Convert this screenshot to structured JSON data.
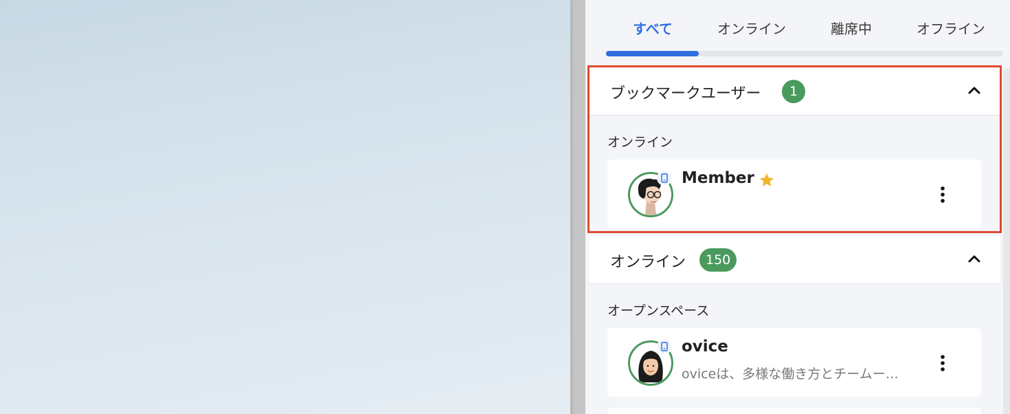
{
  "tabs": [
    {
      "label": "すべて",
      "active": true
    },
    {
      "label": "オンライン",
      "active": false
    },
    {
      "label": "離席中",
      "active": false
    },
    {
      "label": "オフライン",
      "active": false
    }
  ],
  "bookmark_section": {
    "title": "ブックマークユーザー",
    "count": "1",
    "group_label": "オンライン",
    "members": [
      {
        "name": "Member",
        "description": "",
        "bookmarked": true,
        "icon": "star-icon"
      }
    ]
  },
  "online_section": {
    "title": "オンライン",
    "count": "150",
    "group_label": "オープンスペース",
    "members": [
      {
        "name": "ovice",
        "description": "oviceは、多様な働き方とチームー…"
      }
    ]
  },
  "colors": {
    "accent": "#2f6fdf",
    "badge": "#4a9a5e",
    "star": "#f0b429",
    "highlight": "#e04a32"
  }
}
